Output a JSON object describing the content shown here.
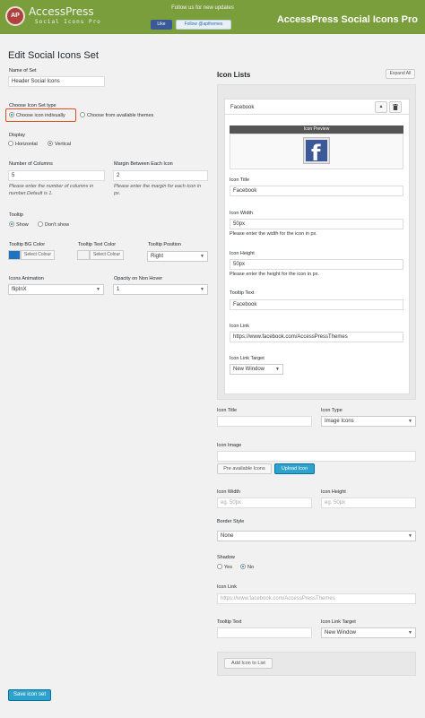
{
  "header": {
    "logo_initials": "AP",
    "logo_title": "AccessPress",
    "logo_subtitle": "Social Icons Pro",
    "follow_text": "Follow us for new updates",
    "fb_like": "Like",
    "twitter_follow": "Follow @apthemes",
    "product_title": "AccessPress Social Icons Pro"
  },
  "page_title": "Edit Social Icons Set",
  "form": {
    "name_label": "Name of Set",
    "name_value": "Header Social Icons",
    "type_label": "Choose Icon Set type",
    "type_opt1": "Choose icon indivually",
    "type_opt2": "Choose from available themes",
    "display_label": "Display",
    "display_opt1": "Horizontal",
    "display_opt2": "Vertical",
    "columns_label": "Number of Columns",
    "columns_value": "5",
    "columns_note": "Please enter the number of columns in number.Default is 1.",
    "margin_label": "Margin Between Each Icon",
    "margin_value": "2",
    "margin_note": "Please enter the margin for each icon in px.",
    "tooltip_label": "Tooltip",
    "tooltip_show": "Show",
    "tooltip_dont": "Don't show",
    "tooltip_bg_label": "Tooltip BG Color",
    "tooltip_text_label": "Tooltip Text Color",
    "tooltip_pos_label": "Tooltip Position",
    "select_colour": "Select Colour",
    "tooltip_pos_value": "Right",
    "anim_label": "Icons Animation",
    "anim_value": "flipInX",
    "opacity_label": "Opacity on Non Hover",
    "opacity_value": "1",
    "save_button": "Save icon set"
  },
  "icon_lists": {
    "title": "Icon Lists",
    "expand_all": "Expand All",
    "card": {
      "title": "Facebook",
      "up_icon": "▲",
      "preview_label": "Icon Preview",
      "preview_glyph": "f",
      "icon_title_label": "Icon Title",
      "icon_title_value": "Facebook",
      "icon_width_label": "Icon Width",
      "icon_width_value": "50px",
      "icon_width_note": "Please enter the width for the icon in px.",
      "icon_height_label": "Icon Height",
      "icon_height_value": "50px",
      "icon_height_note": "Please enter the height for the icon in px.",
      "tooltip_text_label": "Tooltip Text",
      "tooltip_text_value": "Facebook",
      "icon_link_label": "Icon Link",
      "icon_link_value": "https://www.facebook.com/AccessPressThemes",
      "link_target_label": "Icon Link Target",
      "link_target_value": "New Window"
    }
  },
  "add_form": {
    "icon_title_label": "Icon Title",
    "icon_type_label": "Icon Type",
    "icon_type_value": "Image Icons",
    "icon_image_label": "Icon Image",
    "pre_available_btn": "Pre available Icons",
    "upload_btn": "Upload Icon",
    "width_label": "Icon Width",
    "width_placeholder": "eg. 50px",
    "height_label": "Icon Height",
    "height_placeholder": "eg. 50px",
    "border_label": "Border Style",
    "border_value": "None",
    "shadow_label": "Shadow",
    "shadow_yes": "Yes",
    "shadow_no": "No",
    "link_label": "Icon Link",
    "link_placeholder": "https://www.facebook.com/AccessPressThemes",
    "tooltip_label": "Tooltip Text",
    "target_label": "Icon Link Target",
    "target_value": "New Window",
    "add_button": "Add Icon to List"
  },
  "colors": {
    "header_green": "#7a9e3b",
    "primary_blue": "#2ea2cc",
    "highlight_orange": "#e14d1e",
    "tooltip_bg_swatch": "#1e73be",
    "tooltip_text_swatch": "#f2f2f2"
  },
  "icons": [
    "trash-icon",
    "arrow-up-icon",
    "facebook-icon",
    "chevron-down-icon"
  ]
}
